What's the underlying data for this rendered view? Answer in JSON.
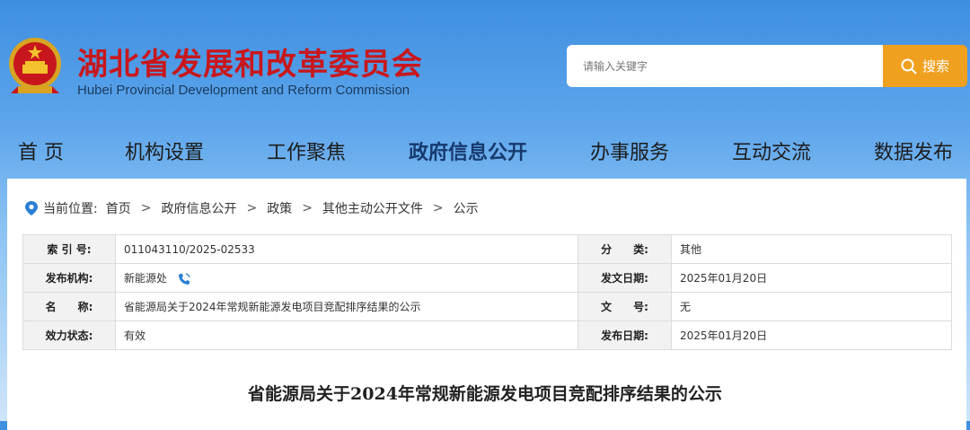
{
  "header": {
    "title": "湖北省发展和改革委员会",
    "subtitle": "Hubei Provincial Development and Reform Commission",
    "emblem_icon": "national-emblem-icon",
    "brand_color": "#c8171c"
  },
  "search": {
    "placeholder": "请输入关键字",
    "button_label": "搜索",
    "button_color": "#f0a01f"
  },
  "nav": {
    "items": [
      {
        "label": "首 页"
      },
      {
        "label": "机构设置"
      },
      {
        "label": "工作聚焦"
      },
      {
        "label": "政府信息公开",
        "active": true
      },
      {
        "label": "办事服务"
      },
      {
        "label": "互动交流"
      },
      {
        "label": "数据发布"
      }
    ]
  },
  "breadcrumb": {
    "prefix": "当前位置:",
    "items": [
      "首页",
      "政府信息公开",
      "政策",
      "其他主动公开文件",
      "公示"
    ],
    "separator": ">"
  },
  "meta": {
    "index_no": {
      "label": "索 引 号:",
      "value": "011043110/2025-02533"
    },
    "category": {
      "label": "分　　类:",
      "value": "其他"
    },
    "publisher": {
      "label": "发布机构:",
      "value": "新能源处"
    },
    "doc_date": {
      "label": "发文日期:",
      "value": "2025年01月20日"
    },
    "name": {
      "label": "名　　称:",
      "value": "省能源局关于2024年常规新能源发电项目竞配排序结果的公示"
    },
    "doc_no": {
      "label": "文　　号:",
      "value": "无"
    },
    "status": {
      "label": "效力状态:",
      "value": "有效"
    },
    "publish_date": {
      "label": "发布日期:",
      "value": "2025年01月20日"
    }
  },
  "document": {
    "title": "省能源局关于2024年常规新能源发电项目竞配排序结果的公示"
  }
}
